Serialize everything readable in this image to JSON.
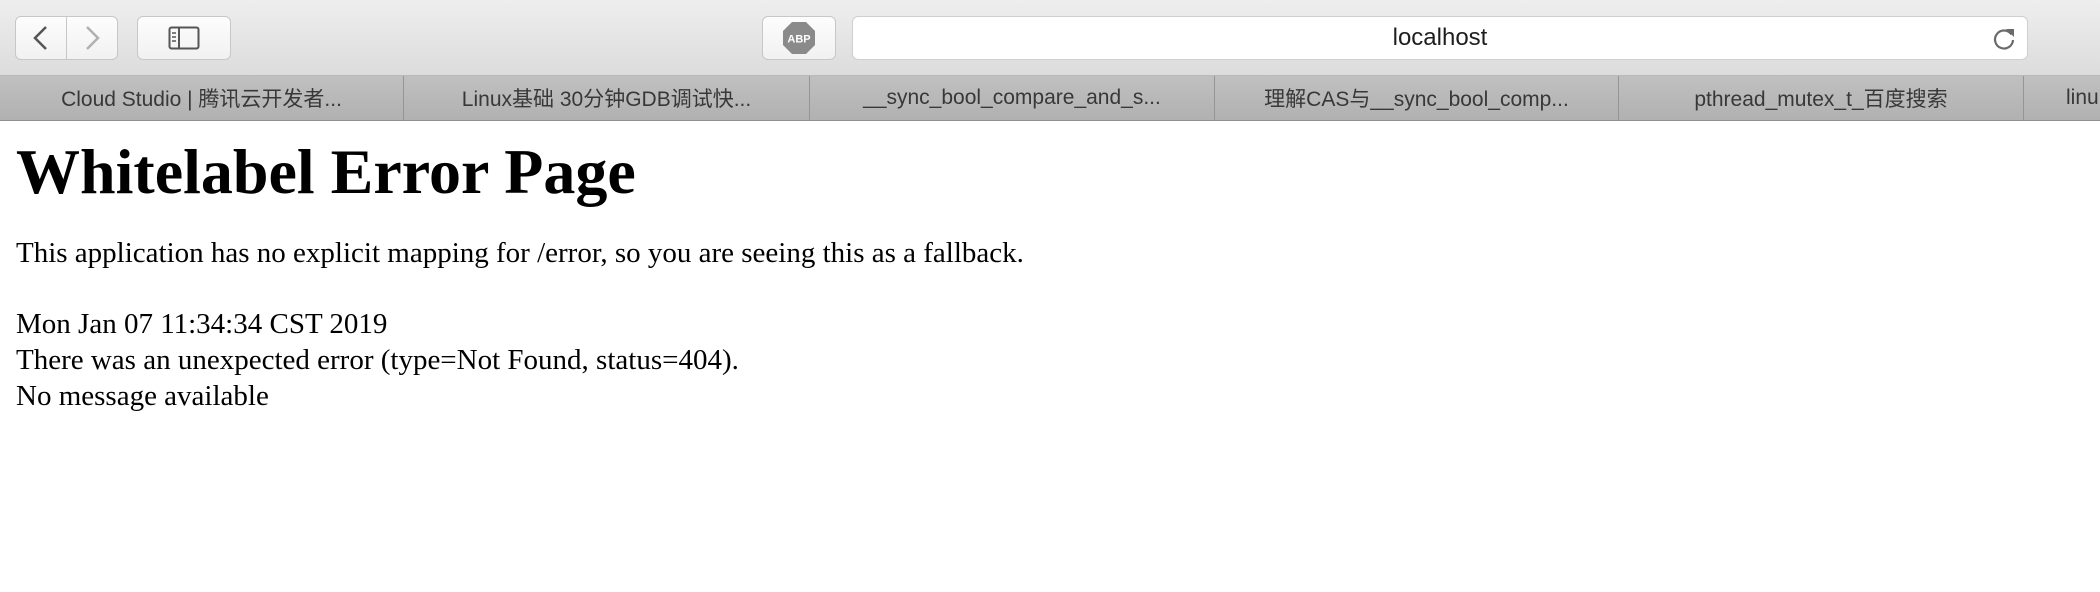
{
  "toolbar": {
    "back_icon": "chevron-left-icon",
    "forward_icon": "chevron-right-icon",
    "sidebar_icon": "sidebar-icon",
    "adblock_label": "ABP",
    "address": "localhost",
    "reload_icon": "reload-icon"
  },
  "tabs": [
    {
      "label": "Cloud Studio | 腾讯云开发者..."
    },
    {
      "label": "Linux基础 30分钟GDB调试快..."
    },
    {
      "label": "__sync_bool_compare_and_s..."
    },
    {
      "label": "理解CAS与__sync_bool_comp..."
    },
    {
      "label": "pthread_mutex_t_百度搜索"
    },
    {
      "label": "linu"
    }
  ],
  "page": {
    "heading": "Whitelabel Error Page",
    "description": "This application has no explicit mapping for /error, so you are seeing this as a fallback.",
    "timestamp": "Mon Jan 07 11:34:34 CST 2019",
    "error_line": "There was an unexpected error (type=Not Found, status=404).",
    "message": "No message available"
  },
  "colors": {
    "abp_badge": "#8a8a8a",
    "tabbar": "#b3b3b3"
  }
}
